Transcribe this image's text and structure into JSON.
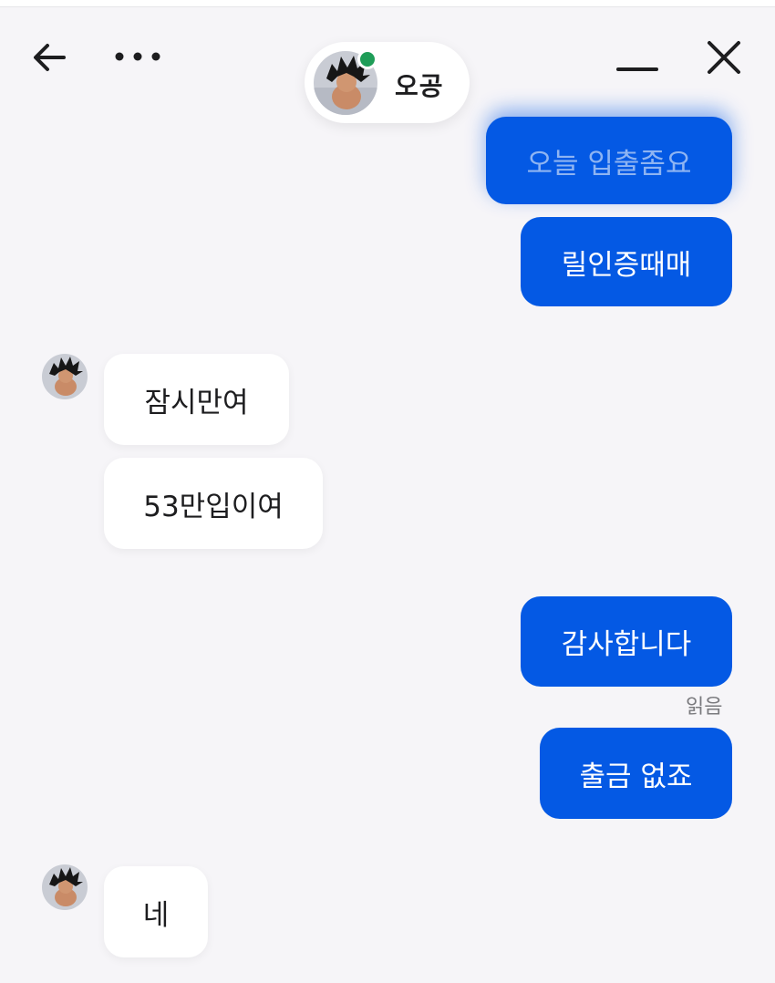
{
  "header": {
    "back_icon": "arrow-left-icon",
    "more_icon": "more-horizontal-icon",
    "minimize_icon": "minimize-icon",
    "close_icon": "close-icon",
    "contact": {
      "name": "오공",
      "online": true,
      "status_color": "#1f9d58"
    }
  },
  "colors": {
    "outgoing_bubble": "#0459e4",
    "incoming_bubble": "#ffffff",
    "background": "#f6f5f8"
  },
  "messages": [
    {
      "direction": "outgoing",
      "text": "오늘 입출좀요"
    },
    {
      "direction": "outgoing",
      "text": "릴인증때매"
    },
    {
      "direction": "incoming",
      "text": "잠시만여"
    },
    {
      "direction": "incoming",
      "text": "53만입이여"
    },
    {
      "direction": "outgoing",
      "text": "감사합니다",
      "receipt": "읽음"
    },
    {
      "direction": "outgoing",
      "text": "출금 없죠"
    },
    {
      "direction": "incoming",
      "text": "네"
    }
  ]
}
